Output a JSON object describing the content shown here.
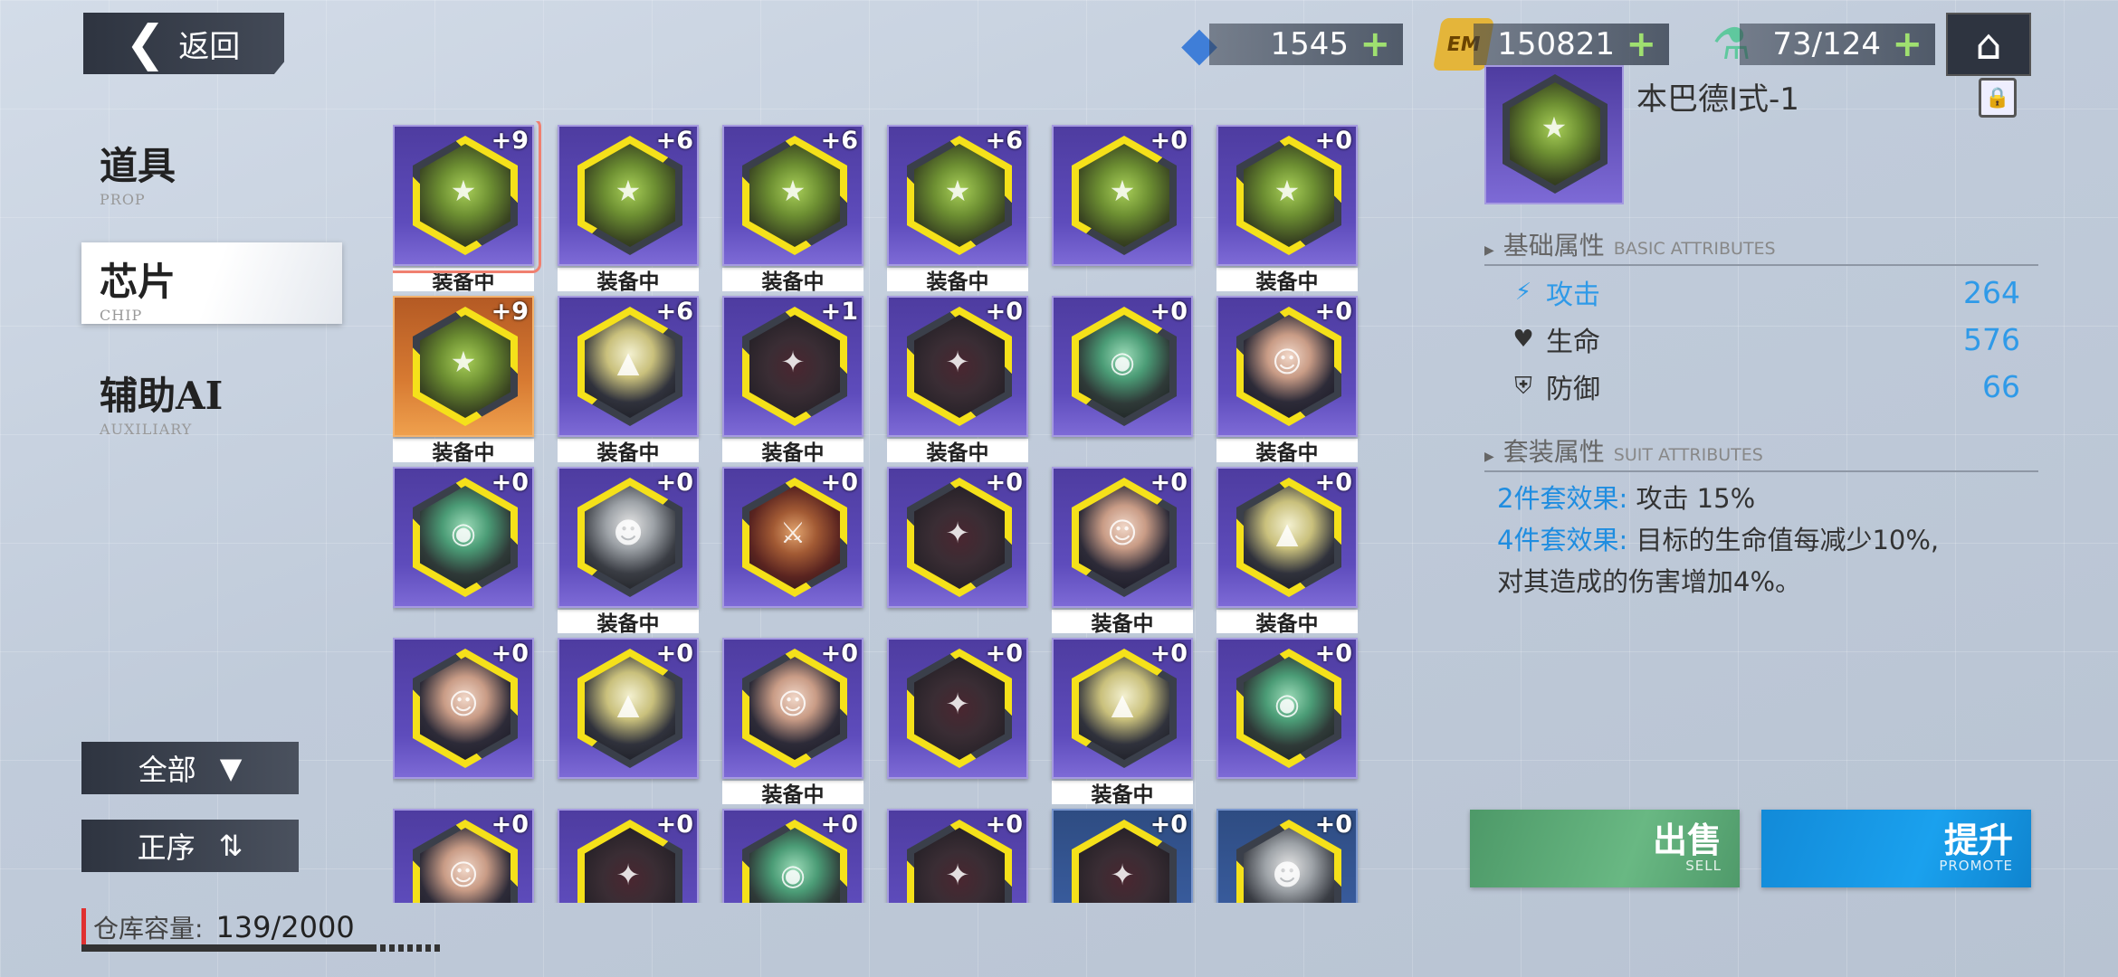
{
  "header": {
    "back_label": "返回",
    "resources": [
      {
        "icon": "crystal-icon",
        "value": "1545"
      },
      {
        "icon": "em-coin-icon",
        "icon_text": "EM",
        "value": "150821"
      },
      {
        "icon": "energy-potion-icon",
        "value": "73/124"
      }
    ],
    "home_icon": "home-icon"
  },
  "sidebar": {
    "items": [
      {
        "label": "道具",
        "sub": "PROP",
        "active": false
      },
      {
        "label": "芯片",
        "sub": "CHIP",
        "active": true
      },
      {
        "label": "辅助AI",
        "sub": "AUXILIARY",
        "active": false
      }
    ],
    "filter_label": "全部",
    "sort_label": "正序",
    "storage_label": "仓库容量:",
    "storage_value": "139/2000",
    "storage_fraction": 0.0695
  },
  "chips": [
    {
      "level": "+9",
      "equipped": true,
      "art": "shield",
      "rarity": "purple",
      "selected": true
    },
    {
      "level": "+6",
      "equipped": true,
      "art": "shield",
      "rarity": "purple"
    },
    {
      "level": "+6",
      "equipped": true,
      "art": "shield",
      "rarity": "purple"
    },
    {
      "level": "+6",
      "equipped": true,
      "art": "shield",
      "rarity": "purple"
    },
    {
      "level": "+0",
      "equipped": false,
      "art": "shield",
      "rarity": "purple"
    },
    {
      "level": "+0",
      "equipped": true,
      "art": "shield",
      "rarity": "purple"
    },
    {
      "level": "+9",
      "equipped": true,
      "art": "shield",
      "rarity": "gold"
    },
    {
      "level": "+6",
      "equipped": true,
      "art": "mask",
      "rarity": "purple"
    },
    {
      "level": "+1",
      "equipped": true,
      "art": "red",
      "rarity": "purple"
    },
    {
      "level": "+0",
      "equipped": true,
      "art": "red",
      "rarity": "purple"
    },
    {
      "level": "+0",
      "equipped": false,
      "art": "green",
      "rarity": "purple"
    },
    {
      "level": "+0",
      "equipped": true,
      "art": "char",
      "rarity": "purple"
    },
    {
      "level": "+0",
      "equipped": false,
      "art": "green",
      "rarity": "purple"
    },
    {
      "level": "+0",
      "equipped": true,
      "art": "silver",
      "rarity": "purple"
    },
    {
      "level": "+0",
      "equipped": false,
      "art": "warrior",
      "rarity": "purple"
    },
    {
      "level": "+0",
      "equipped": false,
      "art": "red",
      "rarity": "purple"
    },
    {
      "level": "+0",
      "equipped": true,
      "art": "char",
      "rarity": "purple"
    },
    {
      "level": "+0",
      "equipped": true,
      "art": "mask",
      "rarity": "purple"
    },
    {
      "level": "+0",
      "equipped": false,
      "art": "char",
      "rarity": "purple"
    },
    {
      "level": "+0",
      "equipped": false,
      "art": "mask",
      "rarity": "purple"
    },
    {
      "level": "+0",
      "equipped": true,
      "art": "char",
      "rarity": "purple"
    },
    {
      "level": "+0",
      "equipped": false,
      "art": "red",
      "rarity": "purple"
    },
    {
      "level": "+0",
      "equipped": true,
      "art": "mask",
      "rarity": "purple"
    },
    {
      "level": "+0",
      "equipped": false,
      "art": "green",
      "rarity": "purple"
    },
    {
      "level": "+0",
      "equipped": false,
      "art": "char",
      "rarity": "purple"
    },
    {
      "level": "+0",
      "equipped": false,
      "art": "red",
      "rarity": "purple"
    },
    {
      "level": "+0",
      "equipped": false,
      "art": "green",
      "rarity": "purple"
    },
    {
      "level": "+0",
      "equipped": false,
      "art": "red",
      "rarity": "purple"
    },
    {
      "level": "+0",
      "equipped": false,
      "art": "red",
      "rarity": "blue"
    },
    {
      "level": "+0",
      "equipped": false,
      "art": "silver",
      "rarity": "blue"
    }
  ],
  "equipped_label": "装备中",
  "detail": {
    "name": "本巴德Ⅰ式-1",
    "basic_title": "基础属性",
    "basic_title_en": "BASIC ATTRIBUTES",
    "attributes": [
      {
        "icon": "lightning-icon",
        "label": "攻击",
        "value": "264",
        "highlight": true
      },
      {
        "icon": "heart-icon",
        "label": "生命",
        "value": "576",
        "highlight": false
      },
      {
        "icon": "shield-icon",
        "label": "防御",
        "value": "66",
        "highlight": false
      }
    ],
    "suit_title": "套装属性",
    "suit_title_en": "SUIT ATTRIBUTES",
    "suit_2_label": "2件套效果:",
    "suit_2_text": "攻击 15%",
    "suit_4_label": "4件套效果:",
    "suit_4_text": "目标的生命值每减少10%,",
    "suit_4_text2": "对其造成的伤害增加4%。"
  },
  "actions": {
    "sell_label": "出售",
    "sell_sub": "SELL",
    "promote_label": "提升",
    "promote_sub": "PROMOTE"
  },
  "colors": {
    "accent_blue": "#1f8de0",
    "purple_card": "#5e4cbc",
    "gold_card": "#d77a32",
    "sell_green": "#5aa874",
    "promote_blue": "#1aa1ee"
  }
}
